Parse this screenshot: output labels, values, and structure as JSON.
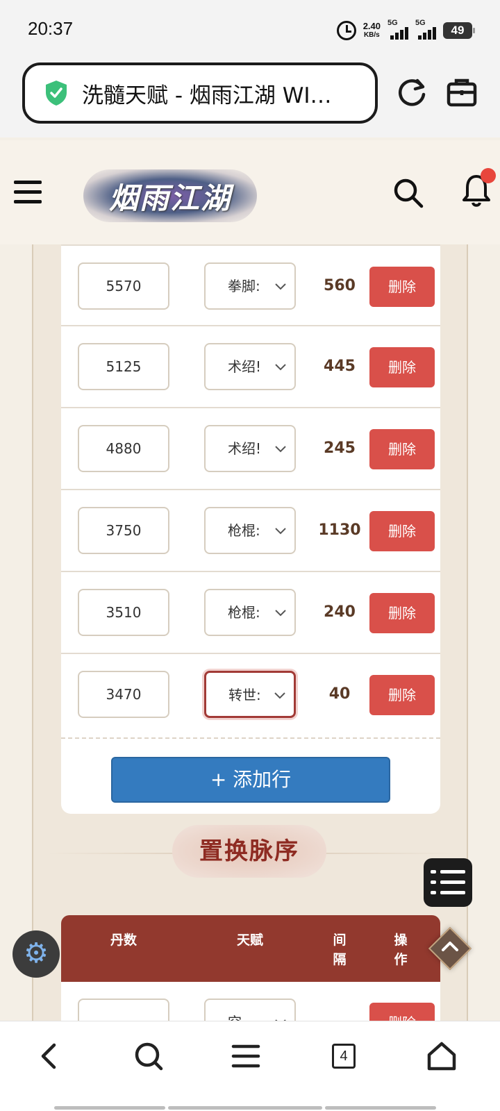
{
  "status_bar": {
    "time": "20:37",
    "net_speed_value": "2.40",
    "net_speed_unit": "KB/s",
    "signal_1": "5G",
    "signal_2": "5G",
    "battery": "49"
  },
  "browser": {
    "url_title": "洗髓天赋 - 烟雨江湖 WI…",
    "icons": [
      "shield-check-icon",
      "reload-icon",
      "toolbox-icon"
    ]
  },
  "site": {
    "logo_text": "烟雨江湖",
    "icons": [
      "hamburger-menu-icon",
      "search-icon",
      "bell-icon"
    ],
    "notification_dot_color": "#e8463c"
  },
  "table1": {
    "rows": [
      {
        "dan": "5570",
        "talent": "拳脚:",
        "interval": "560",
        "delete_label": "删除"
      },
      {
        "dan": "5125",
        "talent": "术绍!",
        "interval": "445",
        "delete_label": "删除"
      },
      {
        "dan": "4880",
        "talent": "术绍!",
        "interval": "245",
        "delete_label": "删除"
      },
      {
        "dan": "3750",
        "talent": "枪棍:",
        "interval": "1130",
        "delete_label": "删除"
      },
      {
        "dan": "3510",
        "talent": "枪棍:",
        "interval": "240",
        "delete_label": "删除"
      },
      {
        "dan": "3470",
        "talent": "转世:",
        "interval": "40",
        "delete_label": "删除"
      }
    ],
    "add_row_label": "+ 添加行"
  },
  "section2": {
    "title": "置换脉序",
    "headers": {
      "dan": "丹数",
      "talent": "天赋",
      "interval_1": "间",
      "interval_2": "隔",
      "op_1": "操",
      "op_2": "作"
    },
    "rows": [
      {
        "dan": "",
        "talent": "空",
        "interval": "-",
        "delete_label": "删除"
      }
    ]
  },
  "bottom_nav": {
    "tab_count": "4",
    "icons": [
      "back-icon",
      "search-icon",
      "menu-icon",
      "tabs-icon",
      "home-icon"
    ]
  },
  "colors": {
    "delete_red": "#d9504a",
    "add_blue": "#347bbf",
    "header_brown": "#92392e",
    "title_red": "#8e2b22"
  }
}
